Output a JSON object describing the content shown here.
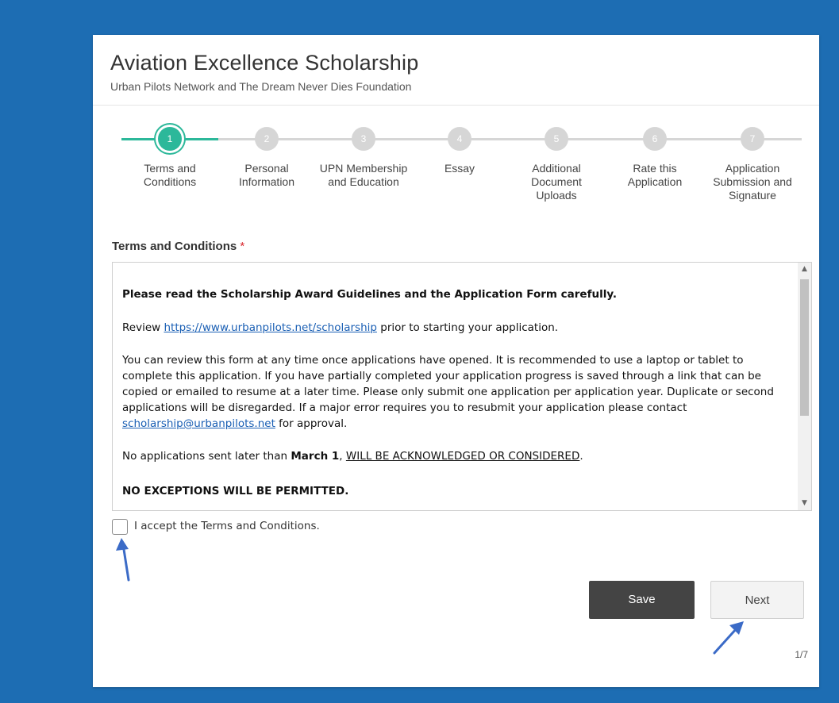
{
  "header": {
    "title": "Aviation Excellence Scholarship",
    "subtitle": "Urban Pilots Network and The Dream Never Dies Foundation"
  },
  "steps": [
    {
      "number": "1",
      "label": "Terms and Conditions",
      "active": true
    },
    {
      "number": "2",
      "label": "Personal Information",
      "active": false
    },
    {
      "number": "3",
      "label": "UPN Membership and Education",
      "active": false
    },
    {
      "number": "4",
      "label": "Essay",
      "active": false
    },
    {
      "number": "5",
      "label": "Additional Document Uploads",
      "active": false
    },
    {
      "number": "6",
      "label": "Rate this Application",
      "active": false
    },
    {
      "number": "7",
      "label": "Application Submission and Signature",
      "active": false
    }
  ],
  "terms": {
    "section_title": "Terms and Conditions",
    "required_marker": "*",
    "heading": "Please read the Scholarship Award Guidelines and the Application Form carefully.",
    "review_prefix": "Review",
    "review_link": "https://www.urbanpilots.net/scholarship",
    "review_suffix": "prior to starting your application.",
    "body": "You can review this form at any time once applications have opened. It is recommended to use a laptop or tablet to complete this application. If you have partially completed your application progress is saved through a link that can be copied or emailed to resume at a later time. Please only submit one application per application year. Duplicate or second applications will be disregarded. If a major error requires you to resubmit your application please contact",
    "contact_email": "scholarship@urbanpilots.net",
    "body_suffix": "for approval.",
    "deadline_prefix": "No applications sent later than",
    "deadline_date": "March 1",
    "deadline_comma": ",",
    "deadline_notice": "WILL BE ACKNOWLEDGED OR CONSIDERED",
    "deadline_period": ".",
    "no_exceptions": "NO EXCEPTIONS WILL BE PERMITTED."
  },
  "accept": {
    "label": "I accept the Terms and Conditions.",
    "checked": false
  },
  "buttons": {
    "save": "Save",
    "next": "Next"
  },
  "pager": "1/7",
  "colors": {
    "background": "#1d6db3",
    "active_step": "#2cb89a",
    "inactive_step": "#d6d6d6",
    "annotation_arrow": "#3b6bc7"
  }
}
